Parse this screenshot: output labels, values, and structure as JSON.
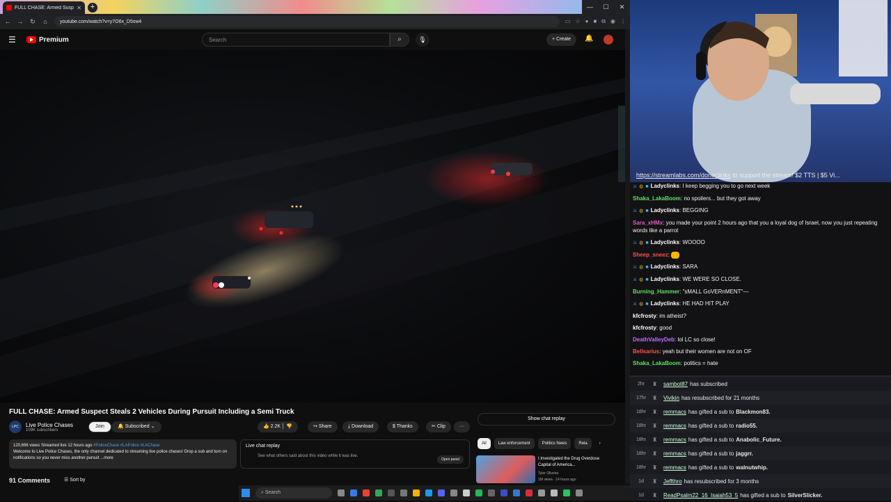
{
  "browser": {
    "tab_title": "FULL CHASE: Armed Suspe",
    "url": "youtube.com/watch?v=y7O6x_D5sw4"
  },
  "youtube": {
    "logo_text": "Premium",
    "search_placeholder": "Search",
    "create_label": "Create",
    "video_title": "FULL CHASE: Armed Suspect Steals 2 Vehicles During Pursuit Including a Semi Truck",
    "channel_name": "Live Police Chases",
    "channel_avatar_text": "LPC",
    "subscribers": "109K subscribers",
    "join_label": "Join",
    "subscribed_label": "Subscribed",
    "likes": "2.2K",
    "share_label": "Share",
    "download_label": "Download",
    "thanks_label": "Thanks",
    "clip_label": "Clip",
    "more_label": "···",
    "desc_stats": "120,696 views  Streamed live 12 hours ago",
    "desc_tags": "#PoliceChase #LAPolice #LAChase",
    "desc_text": "Welcome to Live Police Chases, the only channel dedicated to streaming live police chases! Drop a sub and turn on notifications so you never miss another pursuit",
    "desc_more": "...more",
    "comments_count": "91 Comments",
    "sort_by": "Sort by",
    "chat_replay_title": "Live chat replay",
    "chat_replay_sub": "See what others said about this video while it was live.",
    "open_panel": "Open panel",
    "show_chat_replay": "Show chat replay",
    "chips": [
      "All",
      "Law enforcement",
      "Politics News",
      "Rela"
    ],
    "rec_title": "I Investigated the Drug Overdose Capital of America...",
    "rec_channel": "Tyler Oliveira",
    "rec_stats": "1M views · 14 hours ago"
  },
  "stream": {
    "ticker_link": "https://streamlabs.com/doneclinks",
    "ticker_text": " to support the stream! $2 TTS | $5 Vi..."
  },
  "chat": [
    {
      "user": "Ladyclinks",
      "color": "#ffffff",
      "badges": true,
      "text": "I keep begging you to go next week"
    },
    {
      "user": "Shaka_LakaBoom",
      "color": "#5fe05f",
      "badges": false,
      "text": "no spoilers... but they got away"
    },
    {
      "user": "Ladyclinks",
      "color": "#ffffff",
      "badges": true,
      "text": "BEGGING"
    },
    {
      "user": "Sara_xHMx",
      "color": "#e05cc0",
      "badges": false,
      "text": "you made your point 2 hours ago that you a loyal dog of Israel, now you just repeating words like a parrot"
    },
    {
      "user": "Ladyclinks",
      "color": "#ffffff",
      "badges": true,
      "text": "WOOOO"
    },
    {
      "user": "Sheep_sneez",
      "color": "#ff4f4f",
      "badges": false,
      "text": "",
      "emote": true
    },
    {
      "user": "Ladyclinks",
      "color": "#ffffff",
      "badges": true,
      "text": "SARA"
    },
    {
      "user": "Ladyclinks",
      "color": "#ffffff",
      "badges": true,
      "text": "WE WERE SO CLOSE."
    },
    {
      "user": "Burning_Hammer",
      "color": "#5fe05f",
      "badges": false,
      "text": "\"sMALL GoVERnMENT\"—"
    },
    {
      "user": "Ladyclinks",
      "color": "#ffffff",
      "badges": true,
      "text": "HE HAD HIT PLAY"
    },
    {
      "user": "kfcfrosty",
      "color": "#ffffff",
      "badges": false,
      "text": "im atheist?"
    },
    {
      "user": "kfcfrosty",
      "color": "#ffffff",
      "badges": false,
      "text": "good"
    },
    {
      "user": "DeathValleyDeb",
      "color": "#c06cff",
      "badges": false,
      "text": "lol LC so close!"
    },
    {
      "user": "Bellsarius",
      "color": "#ff4f4f",
      "badges": false,
      "text": "yeah but their women are not on OF"
    },
    {
      "user": "Shaka_LakaBoom",
      "color": "#5fe05f",
      "badges": false,
      "text": "politics = hate"
    }
  ],
  "events": [
    {
      "time": "2hr",
      "user": "sambot87",
      "text": "has subscribed",
      "target": ""
    },
    {
      "time": "17hr",
      "user": "Vivikin",
      "text": "has resubscribed for 21 months",
      "target": ""
    },
    {
      "time": "18hr",
      "user": "remmacs",
      "text": "has gifted a sub to",
      "target": "Blackmon83."
    },
    {
      "time": "18hr",
      "user": "remmacs",
      "text": "has gifted a sub to",
      "target": "radio55."
    },
    {
      "time": "18hr",
      "user": "remmacs",
      "text": "has gifted a sub to",
      "target": "Anabolic_Future."
    },
    {
      "time": "18hr",
      "user": "remmacs",
      "text": "has gifted a sub to",
      "target": "jaggrr."
    },
    {
      "time": "18hr",
      "user": "remmacs",
      "text": "has gifted a sub to",
      "target": "walnutwhip."
    },
    {
      "time": "1d",
      "user": "Jeffthro",
      "text": "has resubscribed for 3 months",
      "target": ""
    },
    {
      "time": "1d",
      "user": "ReadPsalm22_16_Isaiah53_5",
      "text": "has gifted a sub to",
      "target": "SilverSlicker."
    }
  ],
  "taskbar": {
    "search": "Search"
  }
}
